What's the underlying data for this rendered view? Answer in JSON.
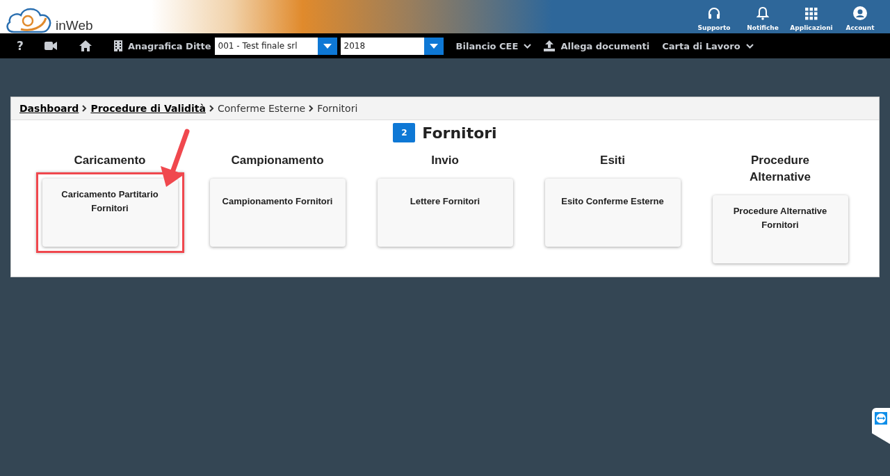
{
  "header": {
    "logo_text": "inWeb",
    "actions": [
      {
        "kind": "headset",
        "label": "Supporto"
      },
      {
        "kind": "bell",
        "label": "Notifiche"
      },
      {
        "kind": "grid",
        "label": "Applicazioni"
      },
      {
        "kind": "user",
        "label": "Account"
      }
    ]
  },
  "navbar": {
    "items": [
      {
        "kind": "help",
        "label": "?"
      },
      {
        "kind": "video"
      },
      {
        "kind": "home"
      },
      {
        "kind": "building",
        "label": "Anagrafica Ditte"
      }
    ],
    "company_select": {
      "value": "001 - Test finale srl"
    },
    "year_select": {
      "value": "2018"
    },
    "menus": [
      {
        "label": "Bilancio CEE",
        "kind": "dropdown"
      },
      {
        "label": "Allega documenti",
        "kind": "upload"
      },
      {
        "label": "Carta di Lavoro",
        "kind": "dropdown"
      }
    ]
  },
  "breadcrumb": [
    {
      "label": "Dashboard",
      "link": true
    },
    {
      "label": "Procedure di Validità",
      "link": true
    },
    {
      "label": "Conferme Esterne",
      "link": false
    },
    {
      "label": "Fornitori",
      "link": false
    }
  ],
  "page": {
    "badge": "2",
    "title": "Fornitori"
  },
  "columns": [
    {
      "heading": "Caricamento",
      "card": "Caricamento Partitario Fornitori",
      "highlighted": true
    },
    {
      "heading": "Campionamento",
      "card": "Campionamento Fornitori",
      "highlighted": false
    },
    {
      "heading": "Invio",
      "card": "Lettere Fornitori",
      "highlighted": false
    },
    {
      "heading": "Esiti",
      "card": "Esito Conferme Esterne",
      "highlighted": false
    },
    {
      "heading": "Procedure Alternative",
      "card": "Procedure Alternative Fornitori",
      "highlighted": false
    }
  ]
}
